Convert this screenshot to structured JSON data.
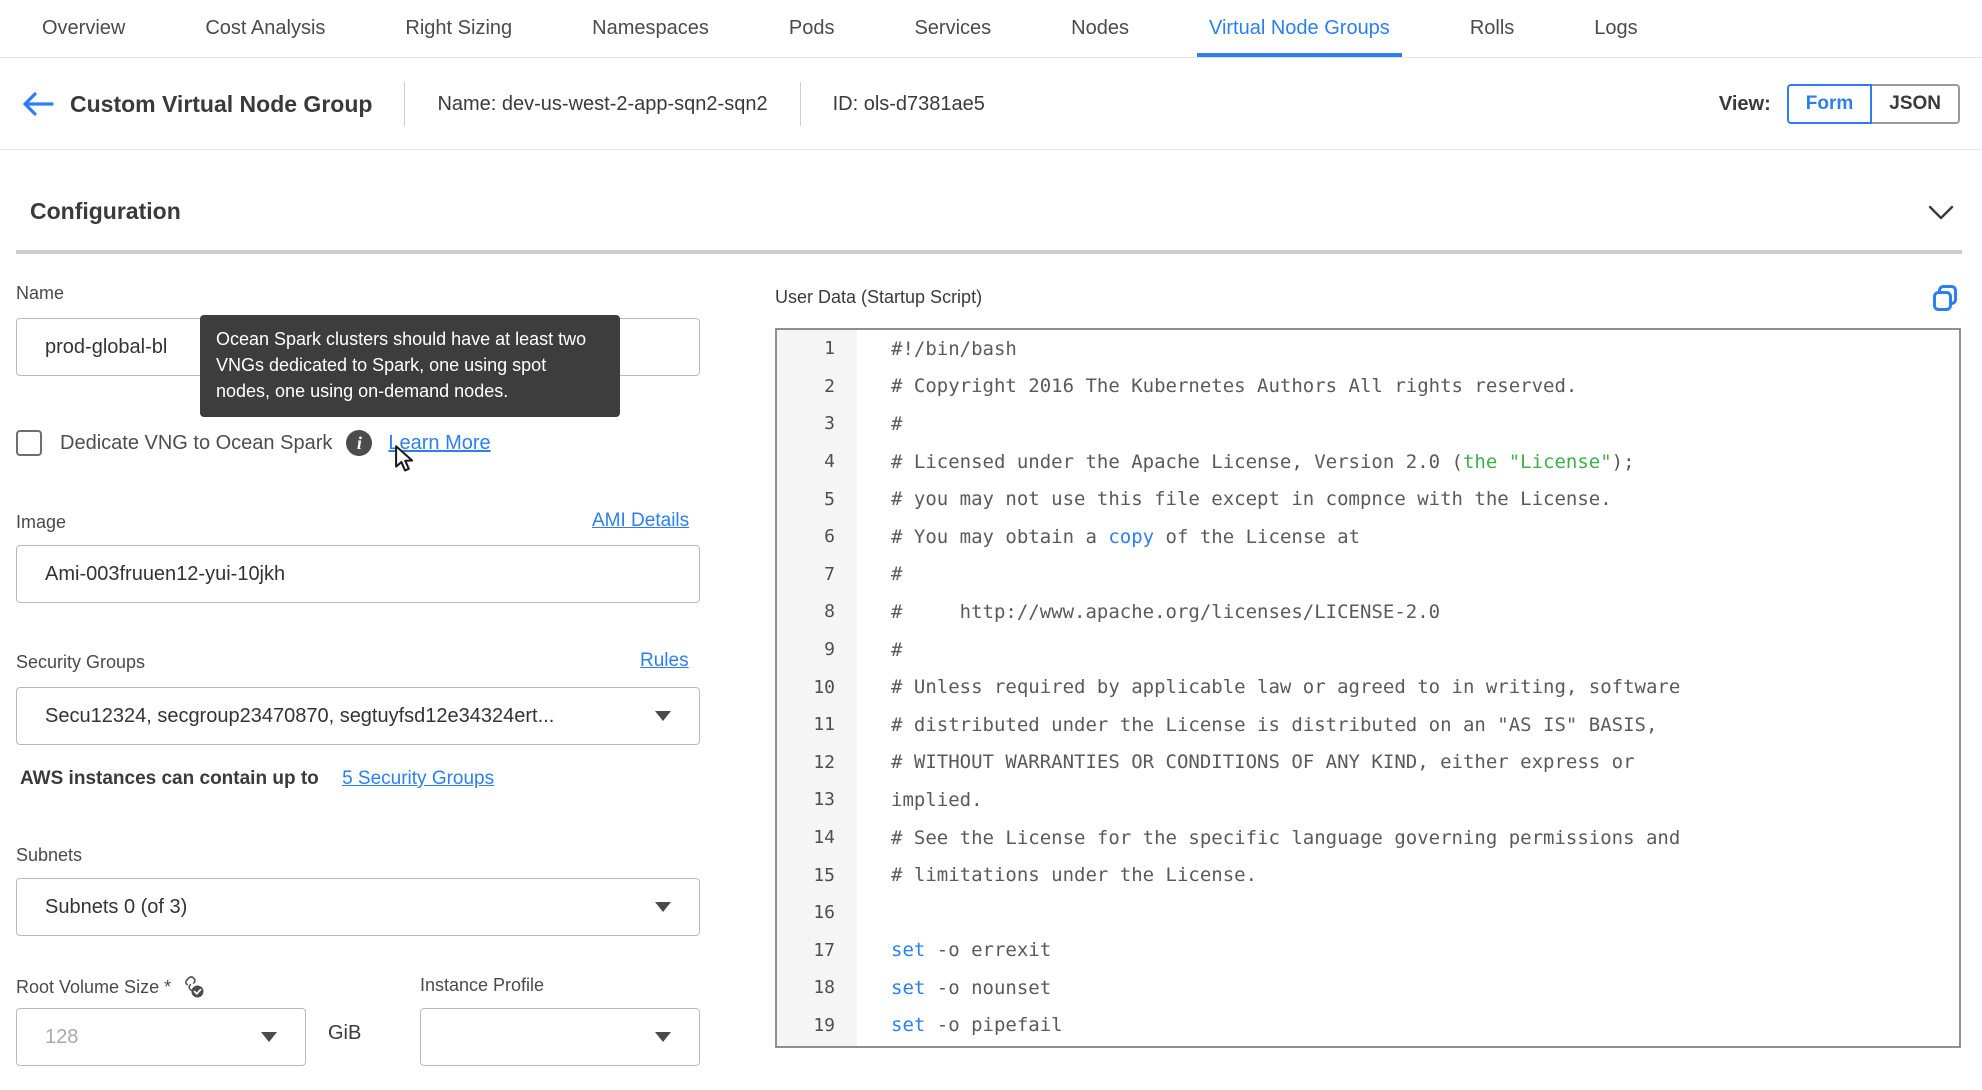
{
  "colors": {
    "accent_blue": "#2b7ff2",
    "code_green": "#3faf46",
    "code_blue": "#2b7ff2",
    "tooltip_bg": "#3d3d3d"
  },
  "tabs": {
    "items": [
      {
        "label": "Overview",
        "active": false
      },
      {
        "label": "Cost Analysis",
        "active": false
      },
      {
        "label": "Right Sizing",
        "active": false
      },
      {
        "label": "Namespaces",
        "active": false
      },
      {
        "label": "Pods",
        "active": false
      },
      {
        "label": "Services",
        "active": false
      },
      {
        "label": "Nodes",
        "active": false
      },
      {
        "label": "Virtual Node Groups",
        "active": true
      },
      {
        "label": "Rolls",
        "active": false
      },
      {
        "label": "Logs",
        "active": false
      }
    ]
  },
  "header": {
    "title": "Custom Virtual Node Group",
    "name_text": "Name: dev-us-west-2-app-sqn2-sqn2",
    "id_text": "ID: ols-d7381ae5",
    "view_label": "View:",
    "form_button": "Form",
    "json_button": "JSON"
  },
  "section": {
    "title": "Configuration"
  },
  "form": {
    "name": {
      "label": "Name",
      "value": "prod-global-bl"
    },
    "tooltip": {
      "text": "Ocean Spark clusters should have at least two VNGs dedicated to Spark, one using spot nodes, one using on-demand nodes."
    },
    "dedicate": {
      "label": "Dedicate VNG to Ocean Spark",
      "learn_more": "Learn More",
      "checked": false
    },
    "image": {
      "label": "Image",
      "link": "AMI Details",
      "value": "Ami-003fruuen12-yui-10jkh"
    },
    "security_groups": {
      "label": "Security Groups",
      "link": "Rules",
      "value": "Secu12324, secgroup23470870, segtuyfsd12e34324ert...",
      "hint_text": "AWS instances can contain up to",
      "hint_link": "5 Security Groups"
    },
    "subnets": {
      "label": "Subnets",
      "value": "Subnets 0 (of 3)"
    },
    "root_volume": {
      "label": "Root Volume Size *",
      "placeholder": "128",
      "unit": "GiB"
    },
    "instance_profile": {
      "label": "Instance Profile",
      "value": ""
    }
  },
  "editor": {
    "title": "User Data (Startup Script)",
    "lines": [
      {
        "n": 1,
        "segments": [
          {
            "t": "#!/bin/bash"
          }
        ]
      },
      {
        "n": 2,
        "segments": [
          {
            "t": "# Copyright 2016 The Kubernetes Authors All rights reserved."
          }
        ]
      },
      {
        "n": 3,
        "segments": [
          {
            "t": "#"
          }
        ]
      },
      {
        "n": 4,
        "segments": [
          {
            "t": "# Licensed under the Apache License, Version 2.0 ("
          },
          {
            "t": "the \"License\"",
            "c": "green"
          },
          {
            "t": ");"
          }
        ]
      },
      {
        "n": 5,
        "segments": [
          {
            "t": "# you may not use this file except in compnce with the License."
          }
        ]
      },
      {
        "n": 6,
        "segments": [
          {
            "t": "# You may obtain a "
          },
          {
            "t": "copy",
            "c": "blue"
          },
          {
            "t": " of the License at"
          }
        ]
      },
      {
        "n": 7,
        "segments": [
          {
            "t": "#"
          }
        ]
      },
      {
        "n": 8,
        "segments": [
          {
            "t": "#     http://www.apache.org/licenses/LICENSE-2.0"
          }
        ]
      },
      {
        "n": 9,
        "segments": [
          {
            "t": "#"
          }
        ]
      },
      {
        "n": 10,
        "segments": [
          {
            "t": "# Unless required by applicable law or agreed to in writing, software"
          }
        ]
      },
      {
        "n": 11,
        "segments": [
          {
            "t": "# distributed under the License is distributed on an \"AS IS\" BASIS,"
          }
        ]
      },
      {
        "n": 12,
        "segments": [
          {
            "t": "# WITHOUT WARRANTIES OR CONDITIONS OF ANY KIND, either express or"
          }
        ]
      },
      {
        "n": 13,
        "segments": [
          {
            "t": "implied."
          }
        ]
      },
      {
        "n": 14,
        "segments": [
          {
            "t": "# See the License for the specific language governing permissions and"
          }
        ]
      },
      {
        "n": 15,
        "segments": [
          {
            "t": "# limitations under the License."
          }
        ]
      },
      {
        "n": 16,
        "segments": [
          {
            "t": ""
          }
        ]
      },
      {
        "n": 17,
        "segments": [
          {
            "t": "set",
            "c": "blue"
          },
          {
            "t": " -o errexit"
          }
        ]
      },
      {
        "n": 18,
        "segments": [
          {
            "t": "set",
            "c": "blue"
          },
          {
            "t": " -o nounset"
          }
        ]
      },
      {
        "n": 19,
        "segments": [
          {
            "t": "set",
            "c": "blue"
          },
          {
            "t": " -o pipefail"
          }
        ]
      }
    ]
  }
}
